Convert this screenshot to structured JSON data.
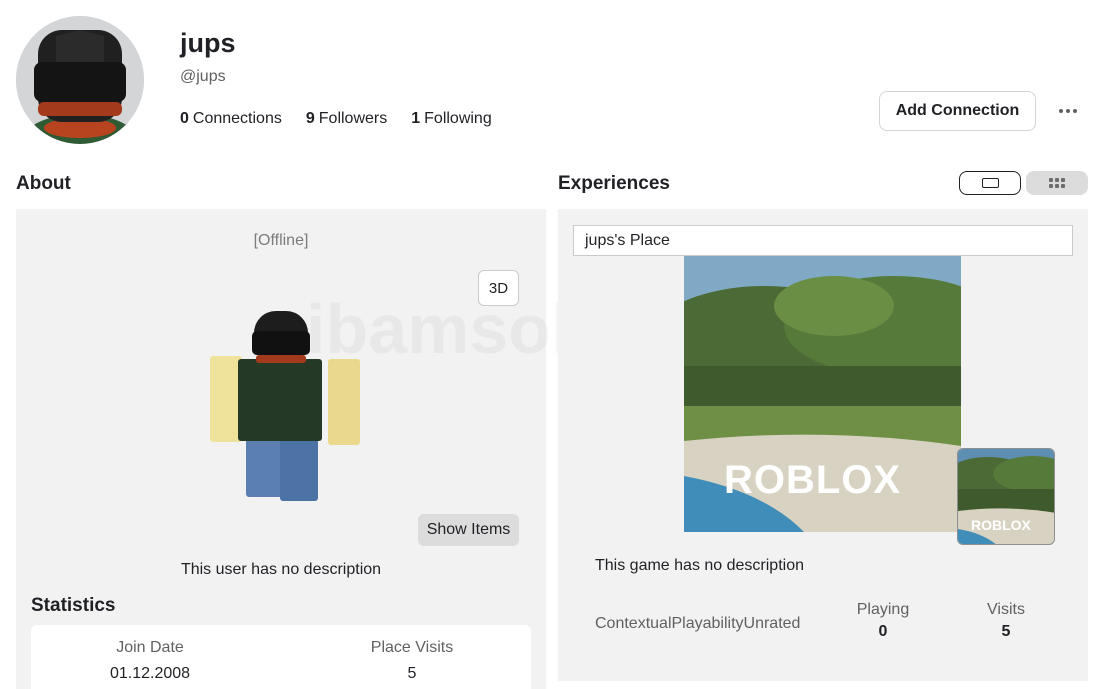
{
  "profile": {
    "display_name": "jups",
    "username": "@jups",
    "connections_count": "0",
    "connections_label": "Connections",
    "followers_count": "9",
    "followers_label": "Followers",
    "following_count": "1",
    "following_label": "Following",
    "add_connection_label": "Add Connection"
  },
  "about": {
    "title": "About",
    "presence": "[Offline]",
    "btn_3d": "3D",
    "show_items": "Show Items",
    "description": "This user has no description"
  },
  "statistics": {
    "title": "Statistics",
    "join_date_label": "Join Date",
    "join_date": "01.12.2008",
    "place_visits_label": "Place Visits",
    "place_visits": "5"
  },
  "experiences": {
    "title": "Experiences",
    "place_name": "jups's Place",
    "thumbnail_logo": "ROBLOX",
    "description": "This game has no description",
    "rating": "ContextualPlayabilityUnrated",
    "playing_label": "Playing",
    "playing": "0",
    "visits_label": "Visits",
    "visits": "5"
  },
  "icons": {
    "more": "more-options-icon",
    "card_view": "card-view-icon",
    "grid_view": "grid-view-icon"
  }
}
